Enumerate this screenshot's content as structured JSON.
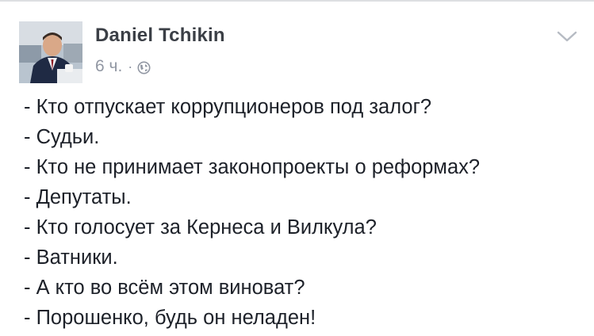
{
  "post": {
    "author": "Daniel Tchikin",
    "time": "6 ч.",
    "separator": "·",
    "privacy_icon": "globe-icon",
    "menu_icon": "chevron-down-icon",
    "lines": [
      "- Кто отпускает коррупционеров под залог?",
      "- Судьи.",
      "- Кто не принимает законопроекты о реформах?",
      "- Депутаты.",
      "- Кто голосует за Кернеса и Вилкула?",
      "- Ватники.",
      "- А кто во всём этом виноват?",
      "- Порошенко, будь он неладен!"
    ]
  }
}
